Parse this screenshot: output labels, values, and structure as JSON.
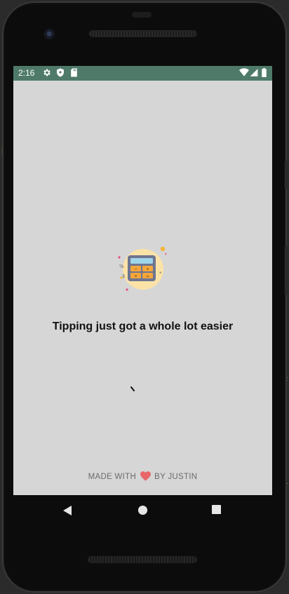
{
  "status_bar": {
    "time": "2:16",
    "icons": [
      "settings-gear-icon",
      "shield-icon",
      "sd-card-icon",
      "wifi-icon",
      "cell-signal-icon",
      "battery-icon"
    ],
    "color": "#4f7a6a"
  },
  "splash": {
    "logo": "calculator-icon",
    "tagline": "Tipping just got a whole lot easier",
    "loading": true
  },
  "footer": {
    "prefix": "MADE WITH",
    "heart": "heart-icon",
    "suffix": "BY JUSTIN",
    "heart_color": "#e8666a"
  },
  "nav_bar": {
    "buttons": [
      "back-icon",
      "home-icon",
      "recents-icon"
    ]
  },
  "colors": {
    "screen_bg": "#d6d6d6",
    "tagline": "#111111",
    "footer_text": "#6b6b6b"
  }
}
